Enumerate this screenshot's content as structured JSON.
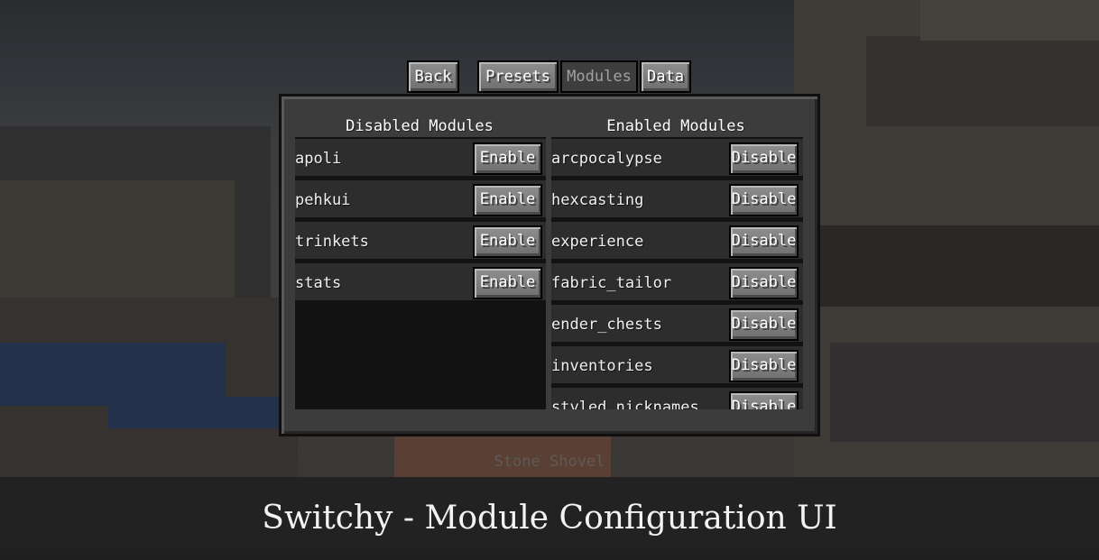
{
  "tabs": {
    "back": "Back",
    "presets": "Presets",
    "modules": "Modules",
    "data": "Data"
  },
  "disabled": {
    "title": "Disabled Modules",
    "action_label": "Enable",
    "items": [
      "apoli",
      "pehkui",
      "trinkets",
      "stats"
    ]
  },
  "enabled": {
    "title": "Enabled Modules",
    "action_label": "Disable",
    "items": [
      "arcpocalypse",
      "hexcasting",
      "experience",
      "fabric_tailor",
      "ender_chests",
      "inventories",
      "styled_nicknames"
    ]
  },
  "held_item": "Stone Shovel",
  "caption": "Switchy - Module Configuration UI"
}
